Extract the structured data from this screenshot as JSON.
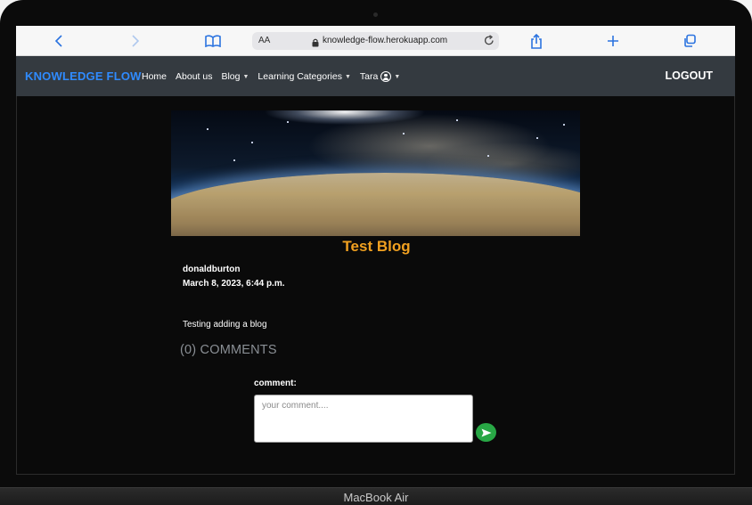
{
  "device": {
    "label": "MacBook Air"
  },
  "browser": {
    "text_size_label": "AA",
    "url": "knowledge-flow.herokuapp.com",
    "icons": [
      "back-icon",
      "forward-icon",
      "bookmarks-icon",
      "lock-icon",
      "reload-icon",
      "share-icon",
      "new-tab-icon",
      "tabs-icon"
    ]
  },
  "navbar": {
    "brand": "KNOWLEDGE FLOW",
    "links": [
      {
        "label": "Home",
        "dropdown": false
      },
      {
        "label": "About us",
        "dropdown": false
      },
      {
        "label": "Blog",
        "dropdown": true
      },
      {
        "label": "Learning Categories",
        "dropdown": true
      },
      {
        "label": "Tara",
        "dropdown": true
      }
    ],
    "logout": "LOGOUT"
  },
  "post": {
    "title": "Test Blog",
    "author": "donaldburton",
    "date": "March 8, 2023, 6:44 p.m.",
    "body": "Testing adding a blog"
  },
  "comments": {
    "heading": "(0) COMMENTS",
    "label": "comment:",
    "placeholder": "your comment....",
    "value": ""
  },
  "colors": {
    "brand": "#2f8bff",
    "title": "#f0a020",
    "navbar_bg": "#343a40",
    "send_button": "#28a745",
    "browser_icons": "#2b73e0"
  }
}
